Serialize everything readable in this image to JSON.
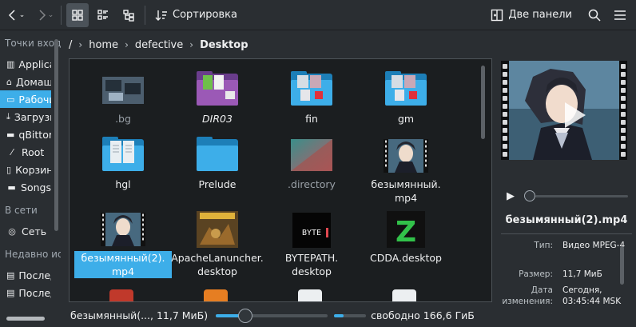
{
  "toolbar": {
    "sort_label": "Сортировка",
    "split_label": "Две панели"
  },
  "sidebar": {
    "places_heading": "Точки входа",
    "places": [
      {
        "label": "Applications",
        "icon": "apps-icon"
      },
      {
        "label": "Домашняя папка",
        "icon": "home-icon"
      },
      {
        "label": "Рабочий стол",
        "icon": "desktop-icon"
      },
      {
        "label": "Загрузки",
        "icon": "download-icon"
      },
      {
        "label": "qBittorrent",
        "icon": "folder-icon"
      },
      {
        "label": "Root",
        "icon": "root-icon"
      },
      {
        "label": "Корзина",
        "icon": "trash-icon"
      },
      {
        "label": "Songs",
        "icon": "folder-icon"
      }
    ],
    "network_heading": "В сети",
    "network": [
      {
        "label": "Сеть",
        "icon": "network-icon"
      }
    ],
    "recent_heading": "Недавно использованные",
    "recent": [
      {
        "label": "Последние файлы",
        "icon": "document-icon"
      },
      {
        "label": "Последние места",
        "icon": "document-icon"
      }
    ]
  },
  "breadcrumb": [
    "/",
    "home",
    "defective",
    "Desktop"
  ],
  "files": [
    {
      "name": ".bg",
      "kind": "image-folder"
    },
    {
      "name": "DIR03",
      "kind": "purple-folder"
    },
    {
      "name": "fin",
      "kind": "folder-pics"
    },
    {
      "name": "gm",
      "kind": "folder-pics"
    },
    {
      "name": "hgl",
      "kind": "folder-docs"
    },
    {
      "name": "Prelude",
      "kind": "folder"
    },
    {
      "name": ".directory",
      "kind": "gradient"
    },
    {
      "name": "безымянный.\nmp4",
      "kind": "video"
    },
    {
      "name": "безымянный(2).\nmp4",
      "kind": "video"
    },
    {
      "name": "ApacheLanuncher.desktop",
      "kind": "game"
    },
    {
      "name": "BYTEPATH.\ndesktop",
      "kind": "bytepath"
    },
    {
      "name": "CDDA.desktop",
      "kind": "cdda"
    }
  ],
  "status": {
    "selection": "безымянный(..., 11,7 МиБ)",
    "free_space": "свободно 166,6 ГиБ",
    "zoom_fraction": 0.26,
    "disk_used_fraction": 0.3
  },
  "info": {
    "title": "безымянный(2).mp4",
    "type_label": "Тип:",
    "type_value": "Видео MPEG-4",
    "size_label": "Размер:",
    "size_value": "11,7 МиБ",
    "date_label": "Дата изменения:",
    "date_value": "Сегодня, 03:45:44 MSK"
  },
  "colors": {
    "accent": "#3daee9",
    "background": "#2a2e32",
    "view_background": "#1b1e20"
  }
}
